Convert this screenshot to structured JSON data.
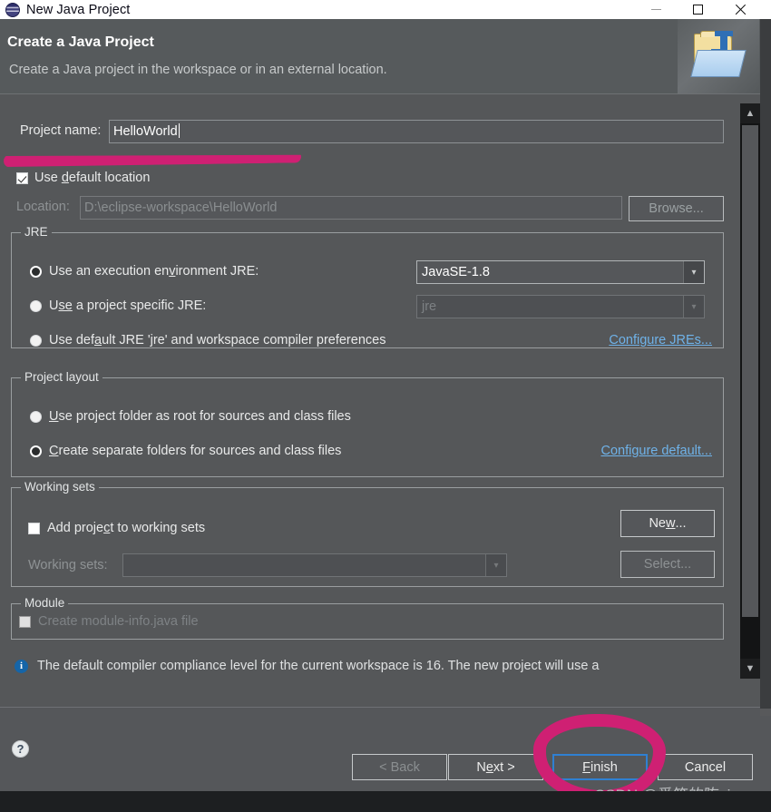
{
  "window": {
    "title": "New Java Project",
    "icon": "eclipse-icon",
    "controls": {
      "minimize": "minimize-icon",
      "maximize": "maximize-icon",
      "close": "close-icon"
    }
  },
  "banner": {
    "title": "Create a Java Project",
    "subtitle": "Create a Java project in the workspace or in an external location.",
    "icon": "java-project-folder-icon"
  },
  "project_name": {
    "label": "Project name:",
    "value": "HelloWorld"
  },
  "default_location": {
    "label_pre": "Use ",
    "label_accel": "d",
    "label_post": "efault location",
    "checked": true
  },
  "location": {
    "label": "Location:",
    "value": "D:\\eclipse-workspace\\HelloWorld",
    "browse_label": "Browse..."
  },
  "jre": {
    "group_title": "JRE",
    "options": [
      {
        "pre": "Use an execution en",
        "accel": "v",
        "post": "ironment JRE:",
        "selected": true
      },
      {
        "pre": "U",
        "accel": "se",
        "post": " a project specific JRE:",
        "selected": false
      },
      {
        "pre": "Use def",
        "accel": "a",
        "post": "ult JRE 'jre' and workspace compiler preferences",
        "selected": false
      }
    ],
    "execution_env_value": "JavaSE-1.8",
    "specific_jre_value": "jre",
    "configure_link": "Configure JREs..."
  },
  "project_layout": {
    "group_title": "Project layout",
    "options": [
      {
        "pre": "",
        "accel": "U",
        "post": "se project folder as root for sources and class files",
        "selected": false
      },
      {
        "pre": "",
        "accel": "C",
        "post": "reate separate folders for sources and class files",
        "selected": true
      }
    ],
    "configure_link": "Configure default..."
  },
  "working_sets": {
    "group_title": "Working sets",
    "add_checkbox": {
      "pre": "Add proje",
      "accel": "c",
      "post": "t to working sets",
      "checked": false
    },
    "combo_label": "Working sets:",
    "combo_value": "",
    "new_button": {
      "pre": "Ne",
      "accel": "w",
      "post": "..."
    },
    "select_button": "Select..."
  },
  "module": {
    "group_title": "Module",
    "checkbox_label": "Create module-info.java file",
    "checked": false
  },
  "status": {
    "icon": "info-icon",
    "message": "The default compiler compliance level for the current workspace is 16. The new project will use a"
  },
  "scrollbar": {
    "up": "chevron-up-icon",
    "down": "chevron-down-icon"
  },
  "footer": {
    "help_icon": "help-icon",
    "buttons": [
      {
        "label": "< Back",
        "state": "disabled"
      },
      {
        "pre": "N",
        "accel": "e",
        "post": "xt >",
        "label": "Next >",
        "state": "enabled"
      },
      {
        "pre": "",
        "accel": "F",
        "post": "inish",
        "label": "Finish",
        "state": "default"
      },
      {
        "label": "Cancel",
        "state": "enabled"
      }
    ]
  },
  "annotations": {
    "color": "#cf2073",
    "underline_target": "project-name-field",
    "circle_target": "finish-button",
    "watermark": "CSDN @爱笑的陈sir"
  }
}
